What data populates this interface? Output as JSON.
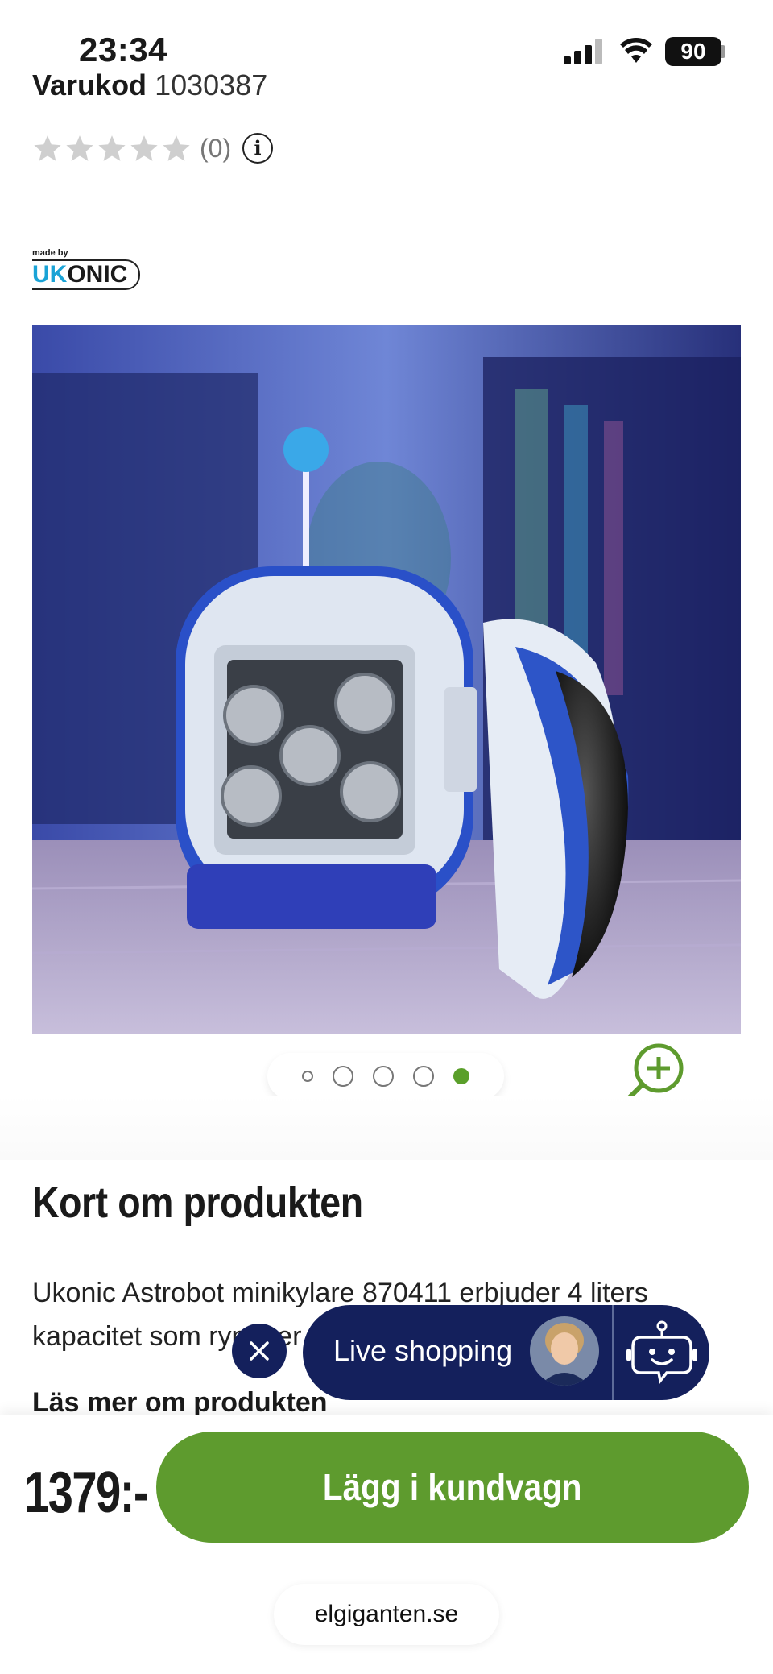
{
  "status_bar": {
    "time": "23:34",
    "battery": "90"
  },
  "product": {
    "sku_label": "Varukod",
    "sku_value": "1030387",
    "rating_count": "(0)",
    "rating_value": 0,
    "rating_max": 5,
    "brand_madeby": "made by",
    "brand_name": "UKONIC"
  },
  "carousel": {
    "total": 5,
    "active_index": 4
  },
  "summary": {
    "title": "Kort om produkten",
    "text": "Ukonic Astrobot minikylare 870411 erbjuder 4 liters kapacitet som rymmer",
    "read_more": "Läs mer om produkten"
  },
  "live_shopping": {
    "label": "Live shopping"
  },
  "purchase": {
    "price": "1379:-",
    "button_label": "Lägg i kundvagn"
  },
  "browser": {
    "url": "elgiganten.se"
  },
  "colors": {
    "accent_green": "#5e9b2e",
    "navy": "#14205c",
    "brand_blue": "#1aa3d6"
  },
  "icons": [
    "signal-icon",
    "wifi-icon",
    "star-icon",
    "info-icon",
    "zoom-in-icon",
    "close-icon",
    "chatbot-icon"
  ]
}
